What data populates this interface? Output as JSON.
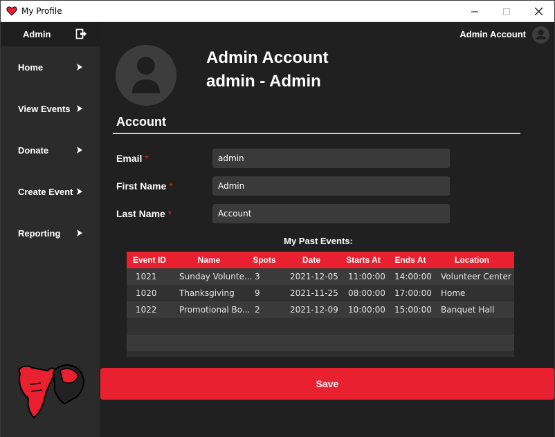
{
  "window": {
    "title": "My Profile"
  },
  "sidebar": {
    "user_name": "Admin",
    "items": [
      {
        "label": "Home"
      },
      {
        "label": "View Events"
      },
      {
        "label": "Donate"
      },
      {
        "label": "Create Event"
      },
      {
        "label": "Reporting"
      }
    ]
  },
  "header": {
    "user_display": "Admin Account"
  },
  "profile": {
    "full_name": "Admin Account",
    "subtitle": "admin - Admin"
  },
  "account": {
    "section_title": "Account",
    "fields": [
      {
        "label": "Email",
        "required_mark": "*",
        "value": "admin"
      },
      {
        "label": "First Name",
        "required_mark": "*",
        "value": "Admin"
      },
      {
        "label": "Last Name",
        "required_mark": "*",
        "value": "Account"
      }
    ]
  },
  "past_events": {
    "title": "My Past Events:",
    "columns": [
      "Event ID",
      "Name",
      "Spots",
      "Date",
      "Starts At",
      "Ends At",
      "Location"
    ],
    "rows": [
      [
        "1021",
        "Sunday Volunte...",
        "3",
        "2021-12-05",
        "11:00:00",
        "14:00:00",
        "Volunteer Center"
      ],
      [
        "1020",
        "Thanksgiving",
        "9",
        "2021-11-25",
        "08:00:00",
        "17:00:00",
        "Home"
      ],
      [
        "1022",
        "Promotional Bo...",
        "2",
        "2021-12-09",
        "10:00:00",
        "15:00:00",
        "Banquet Hall"
      ]
    ]
  },
  "actions": {
    "save_label": "Save"
  },
  "colors": {
    "accent": "#e8202f",
    "sidebar_bg": "#2b2b2b",
    "main_bg": "#202020",
    "input_bg": "#3a3a3a"
  }
}
